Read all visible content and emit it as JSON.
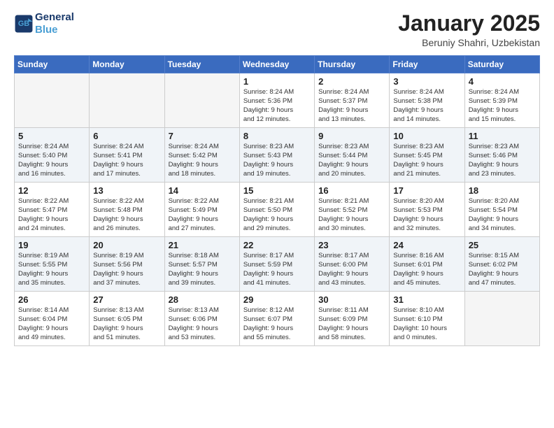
{
  "logo": {
    "line1": "General",
    "line2": "Blue"
  },
  "title": "January 2025",
  "subtitle": "Beruniy Shahri, Uzbekistan",
  "weekdays": [
    "Sunday",
    "Monday",
    "Tuesday",
    "Wednesday",
    "Thursday",
    "Friday",
    "Saturday"
  ],
  "weeks": [
    [
      {
        "day": "",
        "info": ""
      },
      {
        "day": "",
        "info": ""
      },
      {
        "day": "",
        "info": ""
      },
      {
        "day": "1",
        "info": "Sunrise: 8:24 AM\nSunset: 5:36 PM\nDaylight: 9 hours\nand 12 minutes."
      },
      {
        "day": "2",
        "info": "Sunrise: 8:24 AM\nSunset: 5:37 PM\nDaylight: 9 hours\nand 13 minutes."
      },
      {
        "day": "3",
        "info": "Sunrise: 8:24 AM\nSunset: 5:38 PM\nDaylight: 9 hours\nand 14 minutes."
      },
      {
        "day": "4",
        "info": "Sunrise: 8:24 AM\nSunset: 5:39 PM\nDaylight: 9 hours\nand 15 minutes."
      }
    ],
    [
      {
        "day": "5",
        "info": "Sunrise: 8:24 AM\nSunset: 5:40 PM\nDaylight: 9 hours\nand 16 minutes."
      },
      {
        "day": "6",
        "info": "Sunrise: 8:24 AM\nSunset: 5:41 PM\nDaylight: 9 hours\nand 17 minutes."
      },
      {
        "day": "7",
        "info": "Sunrise: 8:24 AM\nSunset: 5:42 PM\nDaylight: 9 hours\nand 18 minutes."
      },
      {
        "day": "8",
        "info": "Sunrise: 8:23 AM\nSunset: 5:43 PM\nDaylight: 9 hours\nand 19 minutes."
      },
      {
        "day": "9",
        "info": "Sunrise: 8:23 AM\nSunset: 5:44 PM\nDaylight: 9 hours\nand 20 minutes."
      },
      {
        "day": "10",
        "info": "Sunrise: 8:23 AM\nSunset: 5:45 PM\nDaylight: 9 hours\nand 21 minutes."
      },
      {
        "day": "11",
        "info": "Sunrise: 8:23 AM\nSunset: 5:46 PM\nDaylight: 9 hours\nand 23 minutes."
      }
    ],
    [
      {
        "day": "12",
        "info": "Sunrise: 8:22 AM\nSunset: 5:47 PM\nDaylight: 9 hours\nand 24 minutes."
      },
      {
        "day": "13",
        "info": "Sunrise: 8:22 AM\nSunset: 5:48 PM\nDaylight: 9 hours\nand 26 minutes."
      },
      {
        "day": "14",
        "info": "Sunrise: 8:22 AM\nSunset: 5:49 PM\nDaylight: 9 hours\nand 27 minutes."
      },
      {
        "day": "15",
        "info": "Sunrise: 8:21 AM\nSunset: 5:50 PM\nDaylight: 9 hours\nand 29 minutes."
      },
      {
        "day": "16",
        "info": "Sunrise: 8:21 AM\nSunset: 5:52 PM\nDaylight: 9 hours\nand 30 minutes."
      },
      {
        "day": "17",
        "info": "Sunrise: 8:20 AM\nSunset: 5:53 PM\nDaylight: 9 hours\nand 32 minutes."
      },
      {
        "day": "18",
        "info": "Sunrise: 8:20 AM\nSunset: 5:54 PM\nDaylight: 9 hours\nand 34 minutes."
      }
    ],
    [
      {
        "day": "19",
        "info": "Sunrise: 8:19 AM\nSunset: 5:55 PM\nDaylight: 9 hours\nand 35 minutes."
      },
      {
        "day": "20",
        "info": "Sunrise: 8:19 AM\nSunset: 5:56 PM\nDaylight: 9 hours\nand 37 minutes."
      },
      {
        "day": "21",
        "info": "Sunrise: 8:18 AM\nSunset: 5:57 PM\nDaylight: 9 hours\nand 39 minutes."
      },
      {
        "day": "22",
        "info": "Sunrise: 8:17 AM\nSunset: 5:59 PM\nDaylight: 9 hours\nand 41 minutes."
      },
      {
        "day": "23",
        "info": "Sunrise: 8:17 AM\nSunset: 6:00 PM\nDaylight: 9 hours\nand 43 minutes."
      },
      {
        "day": "24",
        "info": "Sunrise: 8:16 AM\nSunset: 6:01 PM\nDaylight: 9 hours\nand 45 minutes."
      },
      {
        "day": "25",
        "info": "Sunrise: 8:15 AM\nSunset: 6:02 PM\nDaylight: 9 hours\nand 47 minutes."
      }
    ],
    [
      {
        "day": "26",
        "info": "Sunrise: 8:14 AM\nSunset: 6:04 PM\nDaylight: 9 hours\nand 49 minutes."
      },
      {
        "day": "27",
        "info": "Sunrise: 8:13 AM\nSunset: 6:05 PM\nDaylight: 9 hours\nand 51 minutes."
      },
      {
        "day": "28",
        "info": "Sunrise: 8:13 AM\nSunset: 6:06 PM\nDaylight: 9 hours\nand 53 minutes."
      },
      {
        "day": "29",
        "info": "Sunrise: 8:12 AM\nSunset: 6:07 PM\nDaylight: 9 hours\nand 55 minutes."
      },
      {
        "day": "30",
        "info": "Sunrise: 8:11 AM\nSunset: 6:09 PM\nDaylight: 9 hours\nand 58 minutes."
      },
      {
        "day": "31",
        "info": "Sunrise: 8:10 AM\nSunset: 6:10 PM\nDaylight: 10 hours\nand 0 minutes."
      },
      {
        "day": "",
        "info": ""
      }
    ]
  ]
}
